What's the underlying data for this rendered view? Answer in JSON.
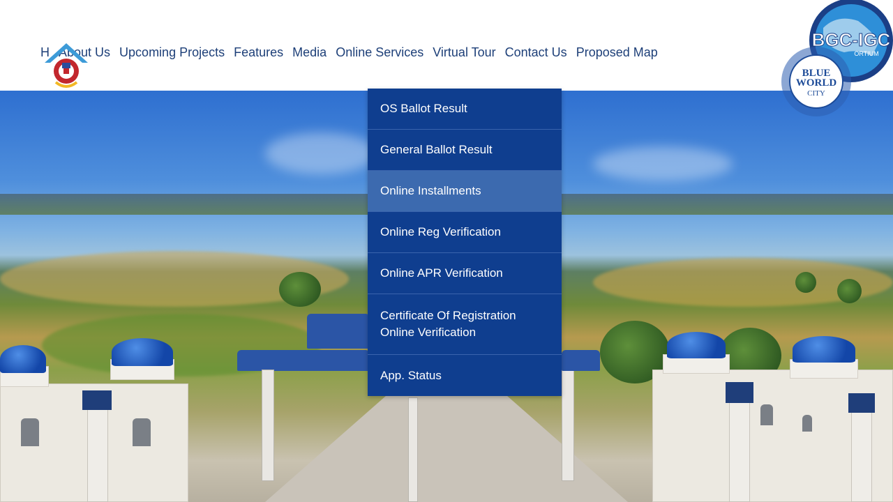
{
  "nav": {
    "items": [
      "H",
      "About Us",
      "Upcoming Projects",
      "Features",
      "Media",
      "Online Services",
      "Virtual Tour",
      "Contact Us",
      "Proposed Map"
    ]
  },
  "dropdown": {
    "items": [
      {
        "label": "OS Ballot Result"
      },
      {
        "label": "General Ballot Result"
      },
      {
        "label": "Online Installments",
        "active": true
      },
      {
        "label": "Online Reg Verification"
      },
      {
        "label": "Online APR Verification"
      },
      {
        "label": "Certificate Of Registration Online Verification"
      },
      {
        "label": "App. Status"
      }
    ]
  },
  "logos": {
    "partner_top": "BGC-IGC",
    "partner_sub": "ORTIUM",
    "partner_main_line1": "BLUE",
    "partner_main_line2": "WORLD",
    "partner_main_line3": "CITY"
  },
  "colors": {
    "nav_text": "#1d3f78",
    "dropdown_bg": "#0f3e8f",
    "dropdown_active": "#3c6aaf"
  }
}
